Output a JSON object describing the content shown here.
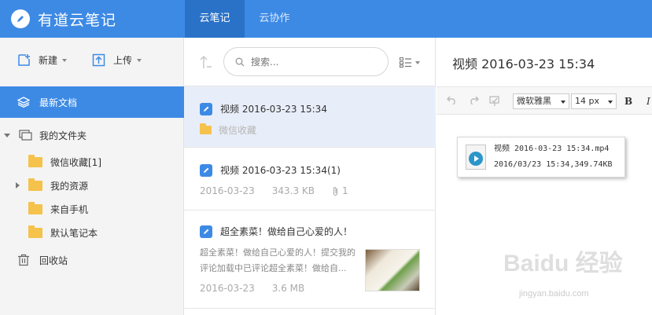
{
  "app": {
    "title": "有道云笔记"
  },
  "tabs": [
    {
      "label": "云笔记"
    },
    {
      "label": "云协作"
    }
  ],
  "sidebar": {
    "new_label": "新建",
    "upload_label": "上传",
    "recent_label": "最新文档",
    "my_folders_label": "我的文件夹",
    "folders": [
      {
        "label": "微信收藏[1]"
      },
      {
        "label": "我的资源"
      },
      {
        "label": "来自手机"
      },
      {
        "label": "默认笔记本"
      }
    ],
    "trash_label": "回收站"
  },
  "list": {
    "search_placeholder": "搜索...",
    "notes": [
      {
        "title": "视频 2016-03-23 15:34",
        "folder": "微信收藏"
      },
      {
        "title": "视频 2016-03-23 15:34(1)",
        "date": "2016-03-23",
        "size": "343.3 KB",
        "attachments": "1"
      },
      {
        "title": "超全素菜！做给自己心爱的人！",
        "snippet": "超全素菜！做给自己心爱的人！提交我的评论加载中已评论超全素菜！做给自...",
        "date": "2016-03-23",
        "size": "3.6 MB"
      }
    ]
  },
  "editor": {
    "title": "视频 2016-03-23 15:34",
    "font": "微软雅黑",
    "font_size": "14 px",
    "bold": "B",
    "italic": "I",
    "attachment": {
      "name": "视频 2016-03-23 15:34.mp4",
      "info": "2016/03/23 15:34,349.74KB"
    }
  },
  "watermark": {
    "main": "Baidu 经验",
    "sub": "jingyan.baidu.com"
  },
  "colors": {
    "accent": "#3d8ae5",
    "tab_active": "#2a72c8",
    "selected_row": "#e8eef9",
    "folder": "#f5c24c"
  }
}
